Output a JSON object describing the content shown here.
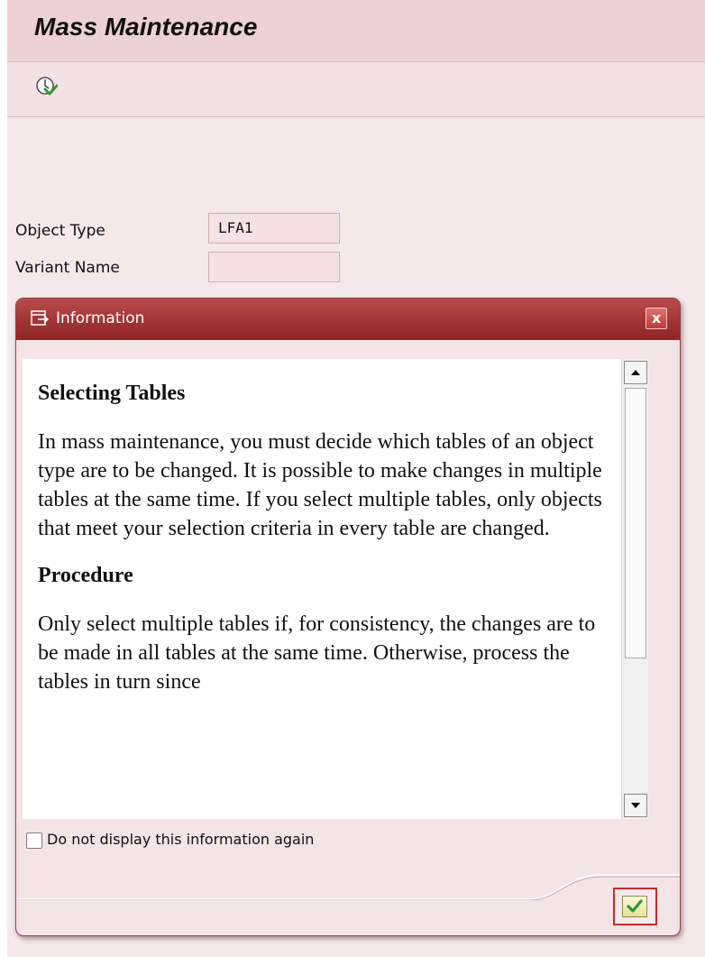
{
  "header": {
    "title": "Mass Maintenance"
  },
  "toolbar": {
    "execute_icon": "execute-icon"
  },
  "form": {
    "object_type": {
      "label": "Object Type",
      "value": "LFA1"
    },
    "variant_name": {
      "label": "Variant Name",
      "value": ""
    }
  },
  "dialog": {
    "title": "Information",
    "close_symbol": "x",
    "heading1": "Selecting Tables",
    "para1": "In mass maintenance, you must decide which tables of an object type are to be changed. It is possible to make changes in multiple tables at the same time. If you select multiple tables, only objects that meet your selection criteria in every table are changed.",
    "heading2": "Procedure",
    "para2": "Only select multiple tables if, for consistency, the changes are to be made in all tables at the same time. Otherwise, process the tables in turn since",
    "checkbox_label": "Do not display this information again",
    "checkbox_checked": false
  },
  "colors": {
    "title_bar": "#ecd1d6",
    "dialog_header": "#8e2424",
    "highlight_border": "#cc2a2a"
  }
}
